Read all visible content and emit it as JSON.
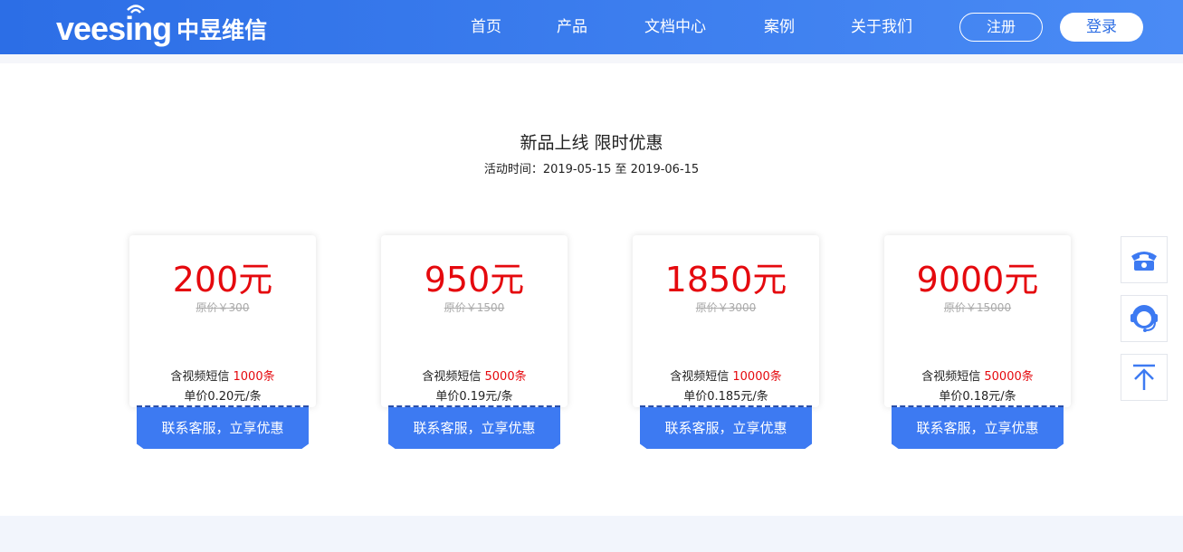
{
  "header": {
    "logo_en": "veesing",
    "logo_cn": "中昱维信",
    "nav": [
      "首页",
      "产品",
      "文档中心",
      "案例",
      "关于我们"
    ],
    "register_label": "注册",
    "login_label": "登录"
  },
  "promo": {
    "title": "新品上线 限时优惠",
    "period": "活动时间：2019-05-15 至 2019-06-15"
  },
  "plans": [
    {
      "price": "200元",
      "original": "原价￥300",
      "includes_prefix": "含视频短信 ",
      "includes_count": "1000条",
      "unit_price": "单价0.20元/条",
      "cta": "联系客服，立享优惠"
    },
    {
      "price": "950元",
      "original": "原价￥1500",
      "includes_prefix": "含视频短信 ",
      "includes_count": "5000条",
      "unit_price": "单价0.19元/条",
      "cta": "联系客服，立享优惠"
    },
    {
      "price": "1850元",
      "original": "原价￥3000",
      "includes_prefix": "含视频短信 ",
      "includes_count": "10000条",
      "unit_price": "单价0.185元/条",
      "cta": "联系客服，立享优惠"
    },
    {
      "price": "9000元",
      "original": "原价￥15000",
      "includes_prefix": "含视频短信 ",
      "includes_count": "50000条",
      "unit_price": "单价0.18元/条",
      "cta": "联系客服，立享优惠"
    }
  ],
  "sidebar": {
    "icons": [
      "phone-icon",
      "customer-service-icon",
      "back-to-top-icon"
    ]
  },
  "colors": {
    "header": "#2f6fe4",
    "price_red": "#e5090e",
    "cta_blue": "#3d7af2",
    "side_icon": "#3d7af2"
  }
}
